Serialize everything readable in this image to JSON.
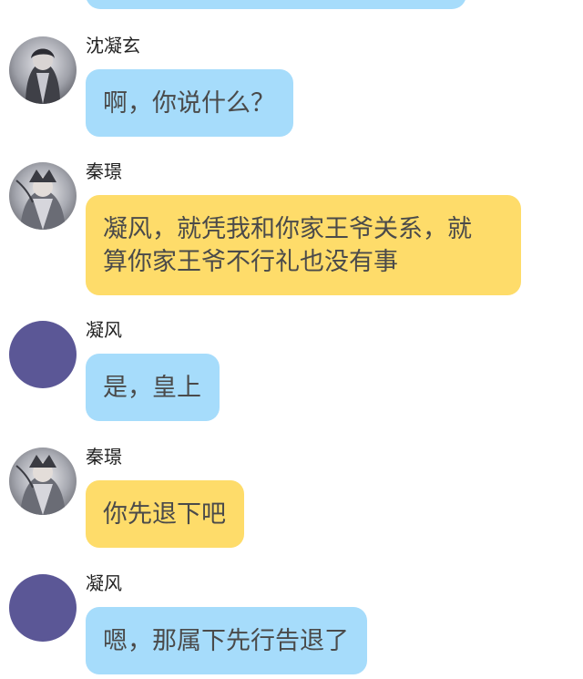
{
  "colors": {
    "bubble_blue": "#a6dcfb",
    "bubble_yellow": "#fedc6a",
    "plain_avatar": "#5b5796",
    "text": "#4a4a4a",
    "name_text": "#222222"
  },
  "messages": [
    {
      "sender": "沈凝玄",
      "avatar": "illustrated-portrait-icon",
      "bubble_color": "blue",
      "text": "啊，你说什么？"
    },
    {
      "sender": "秦璟",
      "avatar": "illustrated-portrait-icon",
      "bubble_color": "yellow",
      "text": "凝风，就凭我和你家王爷关系，就\n算你家王爷不行礼也没有事"
    },
    {
      "sender": "凝风",
      "avatar": "plain-purple-circle-avatar",
      "bubble_color": "blue",
      "text": "是，皇上"
    },
    {
      "sender": "秦璟",
      "avatar": "illustrated-portrait-icon",
      "bubble_color": "yellow",
      "text": "你先退下吧"
    },
    {
      "sender": "凝风",
      "avatar": "plain-purple-circle-avatar",
      "bubble_color": "blue",
      "text": "嗯，那属下先行告退了"
    }
  ]
}
